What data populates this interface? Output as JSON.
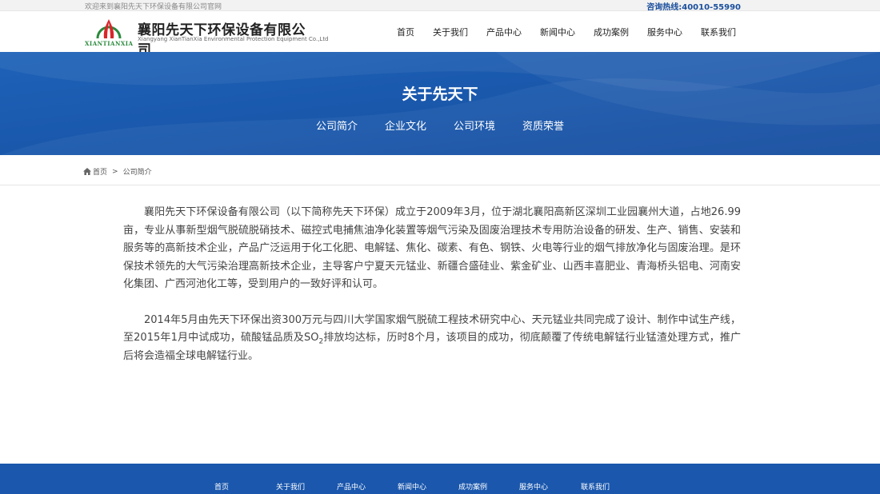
{
  "topbar": {
    "welcome": "欢迎来到襄阳先天下环保设备有限公司官网",
    "hotline": "咨询热线:40010-55990"
  },
  "logo": {
    "mark_text": "XIANTIANXIA",
    "company_cn": "襄阳先天下环保设备有限公司",
    "company_en": "Xiangyang XianTianXia Environmental Protection Equipment Co.,Ltd"
  },
  "nav": {
    "items": [
      "首页",
      "关于我们",
      "产品中心",
      "新闻中心",
      "成功案例",
      "服务中心",
      "联系我们"
    ]
  },
  "banner": {
    "title": "关于先天下",
    "subnav": [
      "公司简介",
      "企业文化",
      "公司环境",
      "资质荣誉"
    ]
  },
  "breadcrumb": {
    "home": "首页",
    "separator": ">",
    "current": "公司简介"
  },
  "content": {
    "p1": "襄阳先天下环保设备有限公司（以下简称先天下环保）成立于2009年3月，位于湖北襄阳高新区深圳工业园襄州大道，占地26.99亩，专业从事新型烟气脱硫脱硝技术、磁控式电捕焦油净化装置等烟气污染及固废治理技术专用防治设备的研发、生产、销售、安装和服务等的高新技术企业，产品广泛运用于化工化肥、电解锰、焦化、碳素、有色、钢铁、火电等行业的烟气排放净化与固废治理。是环保技术领先的大气污染治理高新技术企业，主导客户宁夏天元锰业、新疆合盛硅业、紫金矿业、山西丰喜肥业、青海桥头铝电、河南安化集团、广西河池化工等，受到用户的一致好评和认可。",
    "p2_before": "2014年5月由先天下环保出资300万元与四川大学国家烟气脱硫工程技术研究中心、天元锰业共同完成了设计、制作中试生产线，至2015年1月中试成功，硫酸锰品质及SO",
    "p2_sub": "2",
    "p2_after": "排放均达标，历时8个月，该项目的成功，彻底颠覆了传统电解锰行业锰渣处理方式，推广后将会造福全球电解锰行业。"
  },
  "footer": {
    "nav": [
      "首页",
      "关于我们",
      "产品中心",
      "新闻中心",
      "成功案例",
      "服务中心",
      "联系我们"
    ]
  },
  "colors": {
    "brand_blue": "#1a57ad",
    "hotline_blue": "#1a4e9c",
    "logo_red": "#d8262b",
    "logo_green": "#2a8a3c"
  },
  "icons": {
    "breadcrumb_home": "home-icon",
    "logo_mark": "logo-mark-icon"
  }
}
